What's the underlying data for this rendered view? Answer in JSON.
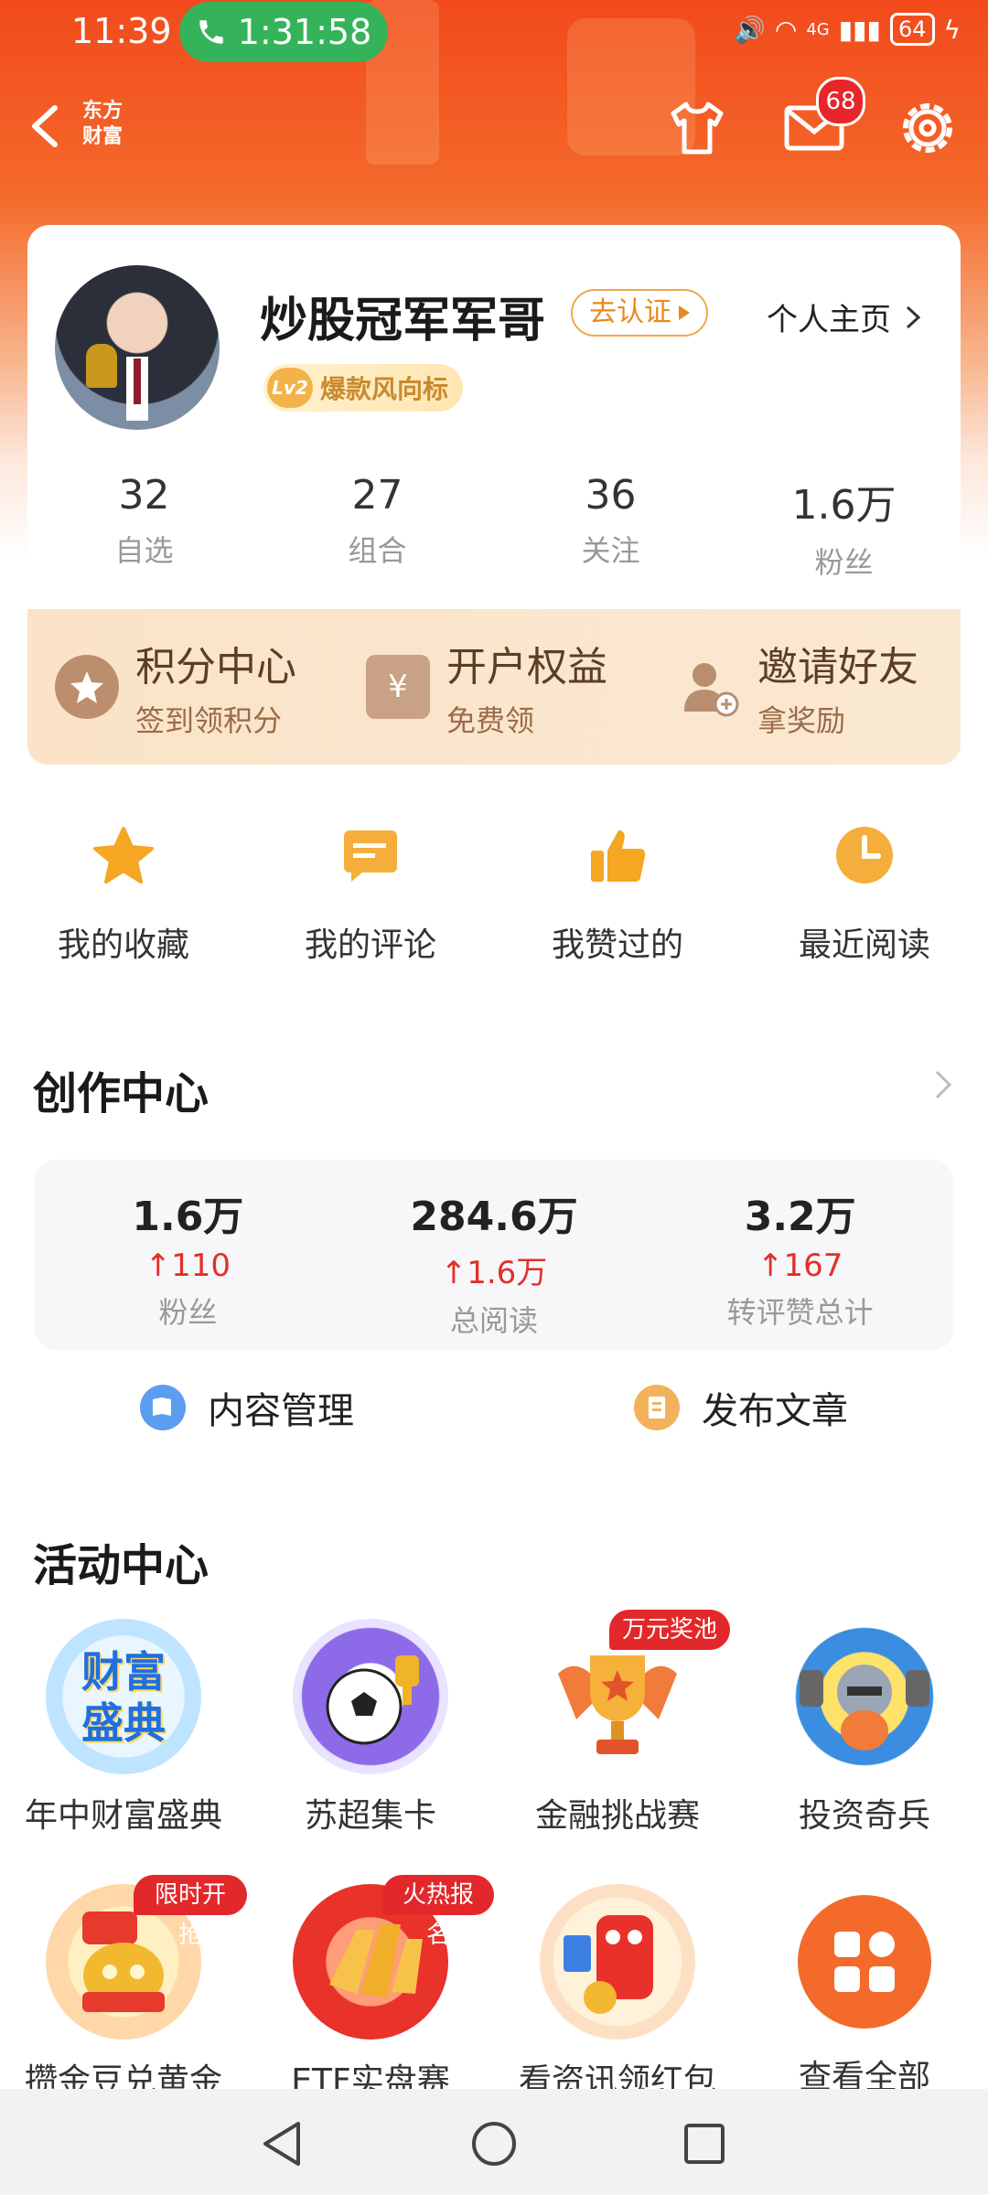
{
  "status_bar": {
    "time": "11:39",
    "call_timer": "1:31:58",
    "network": "4G",
    "battery": "64"
  },
  "header": {
    "brand": "东方\n财富",
    "message_badge": "68"
  },
  "profile": {
    "nickname": "炒股冠军军哥",
    "verify_label": "去认证",
    "homepage_label": "个人主页",
    "level": "Lv2",
    "level_title": "爆款风向标",
    "stats": [
      {
        "value": "32",
        "label": "自选"
      },
      {
        "value": "27",
        "label": "组合"
      },
      {
        "value": "36",
        "label": "关注"
      },
      {
        "value": "1.6万",
        "label": "粉丝"
      }
    ]
  },
  "rewards": [
    {
      "title": "积分中心",
      "subtitle": "签到领积分",
      "icon": "star-coin-icon"
    },
    {
      "title": "开户权益",
      "subtitle": "免费领",
      "icon": "yuan-box-icon"
    },
    {
      "title": "邀请好友",
      "subtitle": "拿奖励",
      "icon": "add-user-icon"
    }
  ],
  "quick_links": [
    {
      "label": "我的收藏",
      "icon": "star-icon"
    },
    {
      "label": "我的评论",
      "icon": "comment-icon"
    },
    {
      "label": "我赞过的",
      "icon": "thumbs-up-icon"
    },
    {
      "label": "最近阅读",
      "icon": "clock-icon"
    }
  ],
  "creator_center": {
    "title": "创作中心",
    "stats": [
      {
        "value": "1.6万",
        "delta": "110",
        "label": "粉丝"
      },
      {
        "value": "284.6万",
        "delta": "1.6万",
        "label": "总阅读"
      },
      {
        "value": "3.2万",
        "delta": "167",
        "label": "转评赞总计"
      }
    ],
    "actions": [
      {
        "label": "内容管理",
        "icon": "content-manage-icon",
        "color": "#5b9ef0"
      },
      {
        "label": "发布文章",
        "icon": "publish-article-icon",
        "color": "#f2b25c"
      }
    ]
  },
  "activity_center": {
    "title": "活动中心",
    "items": [
      {
        "label": "年中财富盛典",
        "tag": "",
        "image_text": "财富\n盛典",
        "icon": "wealth-gala-icon"
      },
      {
        "label": "苏超集卡",
        "tag": "",
        "image_text": "",
        "icon": "soccer-card-icon"
      },
      {
        "label": "金融挑战赛",
        "tag": "万元奖池",
        "image_text": "",
        "icon": "trophy-icon"
      },
      {
        "label": "投资奇兵",
        "tag": "",
        "image_text": "",
        "icon": "soldier-mascot-icon"
      },
      {
        "label": "攒金豆兑黄金",
        "tag": "限时开抢",
        "image_text": "",
        "icon": "gold-bean-icon"
      },
      {
        "label": "ETF实盘赛",
        "tag": "火热报名",
        "image_text": "",
        "icon": "gold-bars-icon"
      },
      {
        "label": "看资讯领红包",
        "tag": "",
        "image_text": "",
        "icon": "red-packet-icon"
      },
      {
        "label": "查看全部",
        "tag": "",
        "image_text": "",
        "icon": "grid-all-icon"
      }
    ]
  },
  "colors": {
    "brand_orange": "#f24a1c",
    "accent_red": "#e1302a",
    "gold": "#f2b25c"
  }
}
